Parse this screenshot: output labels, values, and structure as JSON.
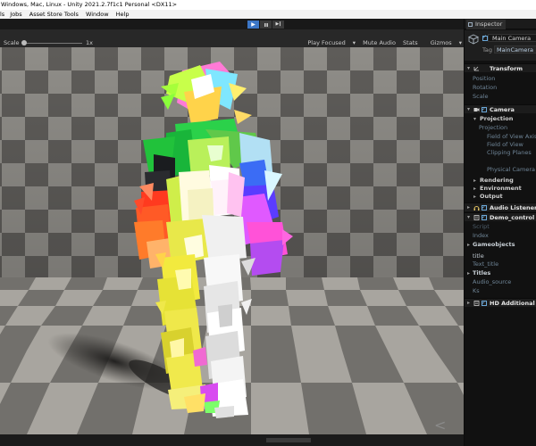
{
  "window": {
    "title": "Windows, Mac, Linux - Unity 2021.2.7f1c1 Personal <DX11>"
  },
  "menu": {
    "items": [
      "ls",
      "Jobs",
      "Asset Store Tools",
      "Window",
      "Help"
    ]
  },
  "toolbar": {
    "play_icon": "▶",
    "pause_icon": "❚❚",
    "step_icon": "▶❙"
  },
  "game_view": {
    "scale_label": "Scale",
    "scale_value": "1x",
    "play_focused": "Play Focused",
    "mute_audio": "Mute Audio",
    "stats": "Stats",
    "gizmos": "Gizmos",
    "nav_arrows": "< >"
  },
  "inspector": {
    "tab_label": "Inspector",
    "object_name": "Main Camera",
    "tag_label": "Tag",
    "tag_value": "MainCamera",
    "transform": {
      "label": "Transform",
      "position": "Position",
      "rotation": "Rotation",
      "scale": "Scale"
    },
    "camera": {
      "label": "Camera",
      "projection_header": "Projection",
      "projection": "Projection",
      "fov_axis": "Field of View Axis",
      "fov": "Field of View",
      "clipping": "Clipping Planes",
      "physical": "Physical Camera",
      "rendering": "Rendering",
      "environment": "Environment",
      "output": "Output"
    },
    "audio_listener": "Audio Listener",
    "demo_control": {
      "label": "Demo_control (Scri",
      "script": "Script",
      "index": "Index",
      "gameobjects": "Gameobjects",
      "title": "title",
      "text_title": "Text_title",
      "titles": "Titles",
      "audio_source": "Audio_source",
      "ks": "Ks"
    },
    "hd_additional": "HD Additional Came"
  },
  "colors": {
    "accent": "#3c77c7",
    "floor_light": "#a8a59f",
    "floor_dark": "#72706c",
    "wall_light": "#8f8d88",
    "wall_dark": "#5e5c59"
  }
}
